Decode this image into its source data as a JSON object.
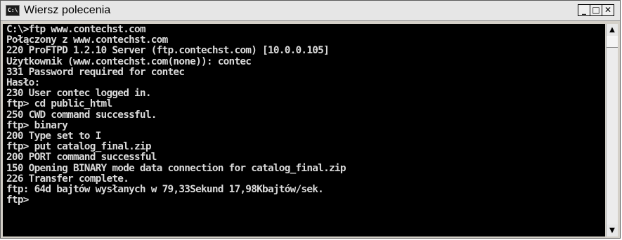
{
  "window": {
    "title": "Wiersz polecenia",
    "icon_name": "console-icon",
    "icon_text": "C:\\",
    "controls": {
      "minimize": "_",
      "maximize": "□",
      "close": "✕"
    }
  },
  "console": {
    "background": "#000000",
    "foreground": "#d9d9d9",
    "lines": [
      "C:\\>ftp www.contechst.com",
      "Połączony z www.contechst.com",
      "220 ProFTPD 1.2.10 Server (ftp.contechst.com) [10.0.0.105]",
      "Użytkownik (www.contechst.com(none)): contec",
      "331 Password required for contec",
      "Hasło:",
      "230 User contec logged in.",
      "ftp> cd public_html",
      "250 CWD command successful.",
      "ftp> binary",
      "200 Type set to I",
      "ftp> put catalog_final.zip",
      "200 PORT command successful",
      "150 Opening BINARY mode data connection for catalog_final.zip",
      "226 Transfer complete.",
      "ftp: 64d bajtów wysłanych w 79,33Sekund 17,98Kbajtów/sek.",
      "ftp>"
    ]
  },
  "scrollbar": {
    "up_icon": "▲",
    "down_icon": "▼"
  }
}
